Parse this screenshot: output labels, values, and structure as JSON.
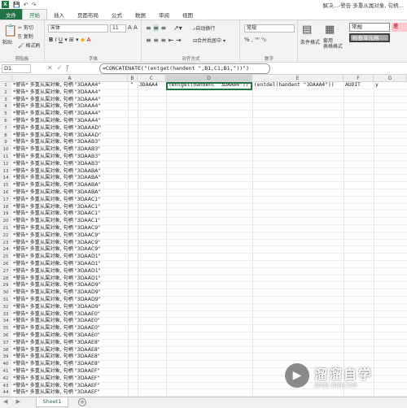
{
  "titlebar": {
    "app_icon": "X",
    "title": "解决…-警告 多重从属对象, 句柄…"
  },
  "tabs": {
    "file": "文件",
    "items": [
      "开始",
      "插入",
      "页面布局",
      "公式",
      "数据",
      "审阅",
      "视图"
    ]
  },
  "ribbon": {
    "clipboard": {
      "paste": "粘贴",
      "cut": "剪切",
      "copy": "复制",
      "format_painter": "格式刷",
      "label": "剪贴板"
    },
    "font": {
      "name": "宋体",
      "size": "11",
      "label": "字体"
    },
    "align": {
      "wrap": "自动换行",
      "merge": "合并后居中",
      "label": "对齐方式"
    },
    "number": {
      "format": "常规",
      "label": "数字"
    },
    "styles": {
      "cond": "条件格式",
      "table": "套用\n表格格式",
      "normal": "常规",
      "check": "检查单元格",
      "bad": "差"
    }
  },
  "formula_bar": {
    "cell_ref": "D1",
    "formula": "=CONCATENATE(\"(entget(handent \",B1,C1,B1,\"))\")"
  },
  "columns": [
    "A",
    "B",
    "C",
    "D",
    "E",
    "F",
    "G"
  ],
  "row1": {
    "b": "\"",
    "c": "3DAAA4",
    "d": "(entget(handent \"3DAAA4\"))",
    "e": "(entdel(handent \"3DAAA4\"))",
    "f": "AUDIT",
    "g": "y"
  },
  "rows": [
    {
      "n": "1",
      "a": "*警告* 多重从属对象, 句柄 \"3DAAA4\""
    },
    {
      "n": "2",
      "a": "*警告* 多重从属对象, 句柄 \"3DAAA4\""
    },
    {
      "n": "3",
      "a": "*警告* 多重从属对象, 句柄 \"3DAAA4\""
    },
    {
      "n": "4",
      "a": "*警告* 多重从属对象, 句柄 \"3DAAA4\""
    },
    {
      "n": "5",
      "a": "*警告* 多重从属对象, 句柄 \"3DAAA4\""
    },
    {
      "n": "6",
      "a": "*警告* 多重从属对象, 句柄 \"3DAAA4\""
    },
    {
      "n": "7",
      "a": "*警告* 多重从属对象, 句柄 \"3DAAAD\""
    },
    {
      "n": "8",
      "a": "*警告* 多重从属对象, 句柄 \"3DAAAD\""
    },
    {
      "n": "9",
      "a": "*警告* 多重从属对象, 句柄 \"3DAAB3\""
    },
    {
      "n": "10",
      "a": "*警告* 多重从属对象, 句柄 \"3DAAB3\""
    },
    {
      "n": "11",
      "a": "*警告* 多重从属对象, 句柄 \"3DAAB3\""
    },
    {
      "n": "12",
      "a": "*警告* 多重从属对象, 句柄 \"3DAAB3\""
    },
    {
      "n": "13",
      "a": "*警告* 多重从属对象, 句柄 \"3DAABA\""
    },
    {
      "n": "14",
      "a": "*警告* 多重从属对象, 句柄 \"3DAABA\""
    },
    {
      "n": "15",
      "a": "*警告* 多重从属对象, 句柄 \"3DAABA\""
    },
    {
      "n": "16",
      "a": "*警告* 多重从属对象, 句柄 \"3DAABA\""
    },
    {
      "n": "17",
      "a": "*警告* 多重从属对象, 句柄 \"3DAAC1\""
    },
    {
      "n": "18",
      "a": "*警告* 多重从属对象, 句柄 \"3DAAC1\""
    },
    {
      "n": "19",
      "a": "*警告* 多重从属对象, 句柄 \"3DAAC1\""
    },
    {
      "n": "20",
      "a": "*警告* 多重从属对象, 句柄 \"3DAAC1\""
    },
    {
      "n": "21",
      "a": "*警告* 多重从属对象, 句柄 \"3DAAC9\""
    },
    {
      "n": "22",
      "a": "*警告* 多重从属对象, 句柄 \"3DAAC9\""
    },
    {
      "n": "23",
      "a": "*警告* 多重从属对象, 句柄 \"3DAAC9\""
    },
    {
      "n": "24",
      "a": "*警告* 多重从属对象, 句柄 \"3DAAC9\""
    },
    {
      "n": "25",
      "a": "*警告* 多重从属对象, 句柄 \"3DAAD1\""
    },
    {
      "n": "26",
      "a": "*警告* 多重从属对象, 句柄 \"3DAAD1\""
    },
    {
      "n": "27",
      "a": "*警告* 多重从属对象, 句柄 \"3DAAD1\""
    },
    {
      "n": "28",
      "a": "*警告* 多重从属对象, 句柄 \"3DAAD1\""
    },
    {
      "n": "29",
      "a": "*警告* 多重从属对象, 句柄 \"3DAAD9\""
    },
    {
      "n": "30",
      "a": "*警告* 多重从属对象, 句柄 \"3DAAD9\""
    },
    {
      "n": "31",
      "a": "*警告* 多重从属对象, 句柄 \"3DAAD9\""
    },
    {
      "n": "32",
      "a": "*警告* 多重从属对象, 句柄 \"3DAAD9\""
    },
    {
      "n": "33",
      "a": "*警告* 多重从属对象, 句柄 \"3DAAE0\""
    },
    {
      "n": "34",
      "a": "*警告* 多重从属对象, 句柄 \"3DAAE0\""
    },
    {
      "n": "35",
      "a": "*警告* 多重从属对象, 句柄 \"3DAAE0\""
    },
    {
      "n": "36",
      "a": "*警告* 多重从属对象, 句柄 \"3DAAE0\""
    },
    {
      "n": "37",
      "a": "*警告* 多重从属对象, 句柄 \"3DAAE8\""
    },
    {
      "n": "38",
      "a": "*警告* 多重从属对象, 句柄 \"3DAAE8\""
    },
    {
      "n": "39",
      "a": "*警告* 多重从属对象, 句柄 \"3DAAE8\""
    },
    {
      "n": "40",
      "a": "*警告* 多重从属对象, 句柄 \"3DAAE8\""
    },
    {
      "n": "41",
      "a": "*警告* 多重从属对象, 句柄 \"3DAAEF\""
    },
    {
      "n": "42",
      "a": "*警告* 多重从属对象, 句柄 \"3DAAEF\""
    },
    {
      "n": "43",
      "a": "*警告* 多重从属对象, 句柄 \"3DAAEF\""
    },
    {
      "n": "44",
      "a": "*警告* 多重从属对象, 句柄 \"3DAAEF\""
    }
  ],
  "sheet": {
    "tab": "Sheet1",
    "add": "+",
    "nav": "◀ ▶"
  },
  "watermark": {
    "name": "溜溜自学",
    "url": "ZIXUE.3D66.COM"
  },
  "colors": {
    "excel_green": "#217346",
    "selection": "#217346",
    "bad_style": "#ffc7ce",
    "normal_style": "#ffffff"
  }
}
